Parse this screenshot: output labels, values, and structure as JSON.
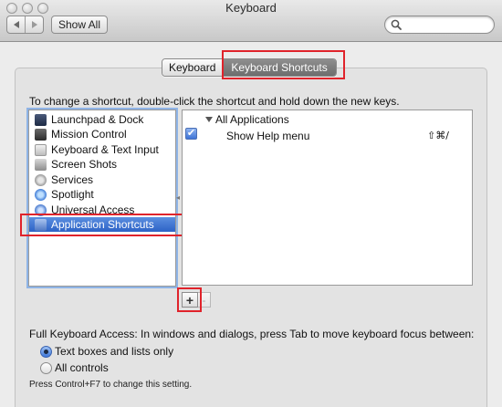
{
  "window": {
    "title": "Keyboard"
  },
  "toolbar": {
    "show_all_label": "Show All",
    "search_placeholder": ""
  },
  "tabs": [
    {
      "label": "Keyboard",
      "selected": false
    },
    {
      "label": "Keyboard Shortcuts",
      "selected": true
    }
  ],
  "instruction": "To change a shortcut, double-click the shortcut and hold down the new keys.",
  "categories": [
    {
      "label": "Launchpad & Dock",
      "icon": "launchpad-icon"
    },
    {
      "label": "Mission Control",
      "icon": "mission-control-icon"
    },
    {
      "label": "Keyboard & Text Input",
      "icon": "keyboard-icon"
    },
    {
      "label": "Screen Shots",
      "icon": "screenshot-icon"
    },
    {
      "label": "Services",
      "icon": "gear-icon"
    },
    {
      "label": "Spotlight",
      "icon": "spotlight-icon"
    },
    {
      "label": "Universal Access",
      "icon": "universal-access-icon"
    },
    {
      "label": "Application Shortcuts",
      "icon": "app-shortcuts-icon",
      "selected": true
    }
  ],
  "shortcuts": {
    "group_label": "All Applications",
    "items": [
      {
        "name": "Show Help menu",
        "keys": "⇧⌘/",
        "enabled": true
      }
    ]
  },
  "buttons": {
    "add": "+",
    "remove": "-"
  },
  "full_keyboard_access": {
    "label": "Full Keyboard Access: In windows and dialogs, press Tab to move keyboard focus between:",
    "options": [
      {
        "label": "Text boxes and lists only",
        "selected": true
      },
      {
        "label": "All controls",
        "selected": false
      }
    ],
    "hint": "Press Control+F7 to change this setting."
  },
  "colors": {
    "highlight": "#e0232b",
    "selection": "#2d63c6"
  }
}
